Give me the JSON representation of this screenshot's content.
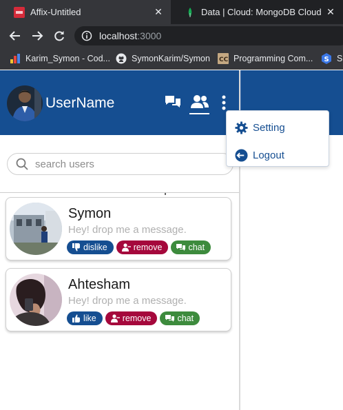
{
  "browser": {
    "tabs": [
      {
        "title": "Affix-Untitled",
        "active": true
      },
      {
        "title": "Data | Cloud: MongoDB Cloud",
        "active": false
      }
    ],
    "url_host": "localhost",
    "url_port": ":3000",
    "bookmarks": [
      {
        "label": "Karim_Symon - Cod...",
        "icon": "chart-bars-icon"
      },
      {
        "label": "SymonKarim/Symon",
        "icon": "github-icon"
      },
      {
        "label": "Programming Com...",
        "icon": "cc-icon"
      },
      {
        "label": "Sp",
        "icon": "s-badge-icon"
      }
    ]
  },
  "header": {
    "username": "UserName",
    "icons": [
      "chat-icon",
      "users-icon",
      "more-vert-icon"
    ]
  },
  "search": {
    "placeholder": "search users"
  },
  "users": [
    {
      "name": "Symon",
      "status": "Hey! drop me a message.",
      "actions": {
        "like": "dislike",
        "remove": "remove",
        "chat": "chat"
      }
    },
    {
      "name": "Ahtesham",
      "status": "Hey! drop me a message.",
      "actions": {
        "like": "like",
        "remove": "remove",
        "chat": "chat"
      }
    }
  ],
  "menu": {
    "setting": "Setting",
    "logout": "Logout"
  },
  "colors": {
    "primary": "#154e91",
    "remove": "#a5083c",
    "chat": "#3d8b3d",
    "chrome_dark": "#202124",
    "chrome_mid": "#35363a"
  }
}
